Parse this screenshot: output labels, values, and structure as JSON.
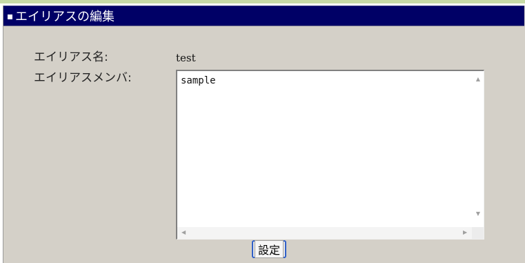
{
  "header": {
    "title": "エイリアスの編集"
  },
  "form": {
    "alias_name_label": "エイリアス名:",
    "alias_name_value": "test",
    "alias_members_label": "エイリアスメンバ:",
    "alias_members_value": "sample",
    "submit_label": "設定"
  },
  "colors": {
    "header_bg": "#000066",
    "panel_bg": "#d4d0c8",
    "top_rule": "#c7dba7"
  }
}
